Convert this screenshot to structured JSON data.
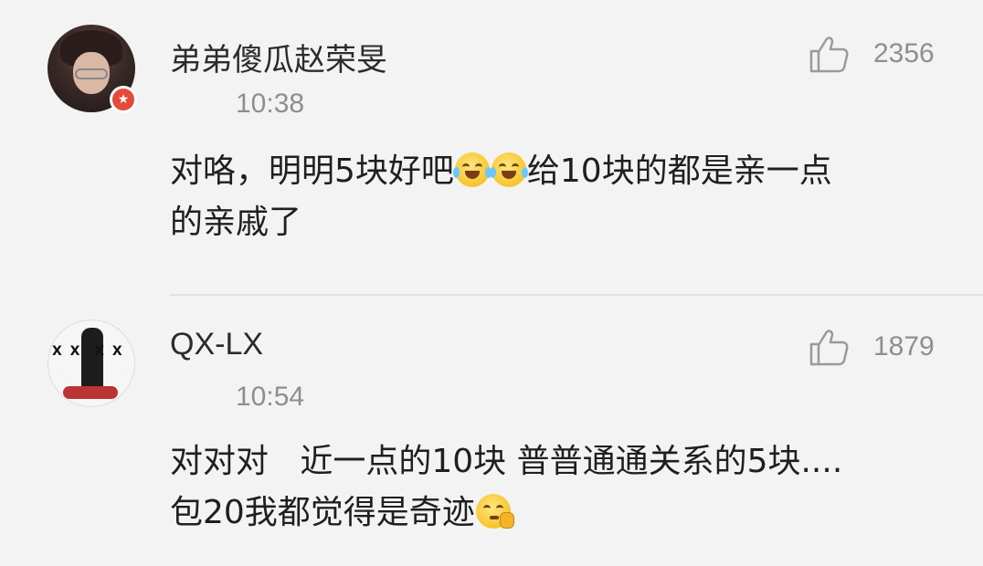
{
  "comments": [
    {
      "username": "弟弟傻瓜赵荣旻",
      "time": "10:38",
      "likes": "2356",
      "badge_icon": "star-badge-icon",
      "text_line1_a": "对咯，明明5块好吧",
      "text_line1_b": "给10块的都是亲一点",
      "text_line2": "的亲戚了",
      "emojis": [
        "laugh-cry-emoji",
        "laugh-cry-emoji"
      ]
    },
    {
      "username": "QX-LX",
      "time": "10:54",
      "likes": "1879",
      "text_line1": "对对对   近一点的10块 普普通通关系的5块....",
      "text_line2": "包20我都觉得是奇迹",
      "emojis": [
        "pensive-emoji"
      ]
    }
  ],
  "colors": {
    "background": "#f3f3f3",
    "muted_text": "#8e8e8e",
    "badge": "#e64a3a"
  },
  "icons": {
    "like": "thumbs-up-icon"
  }
}
